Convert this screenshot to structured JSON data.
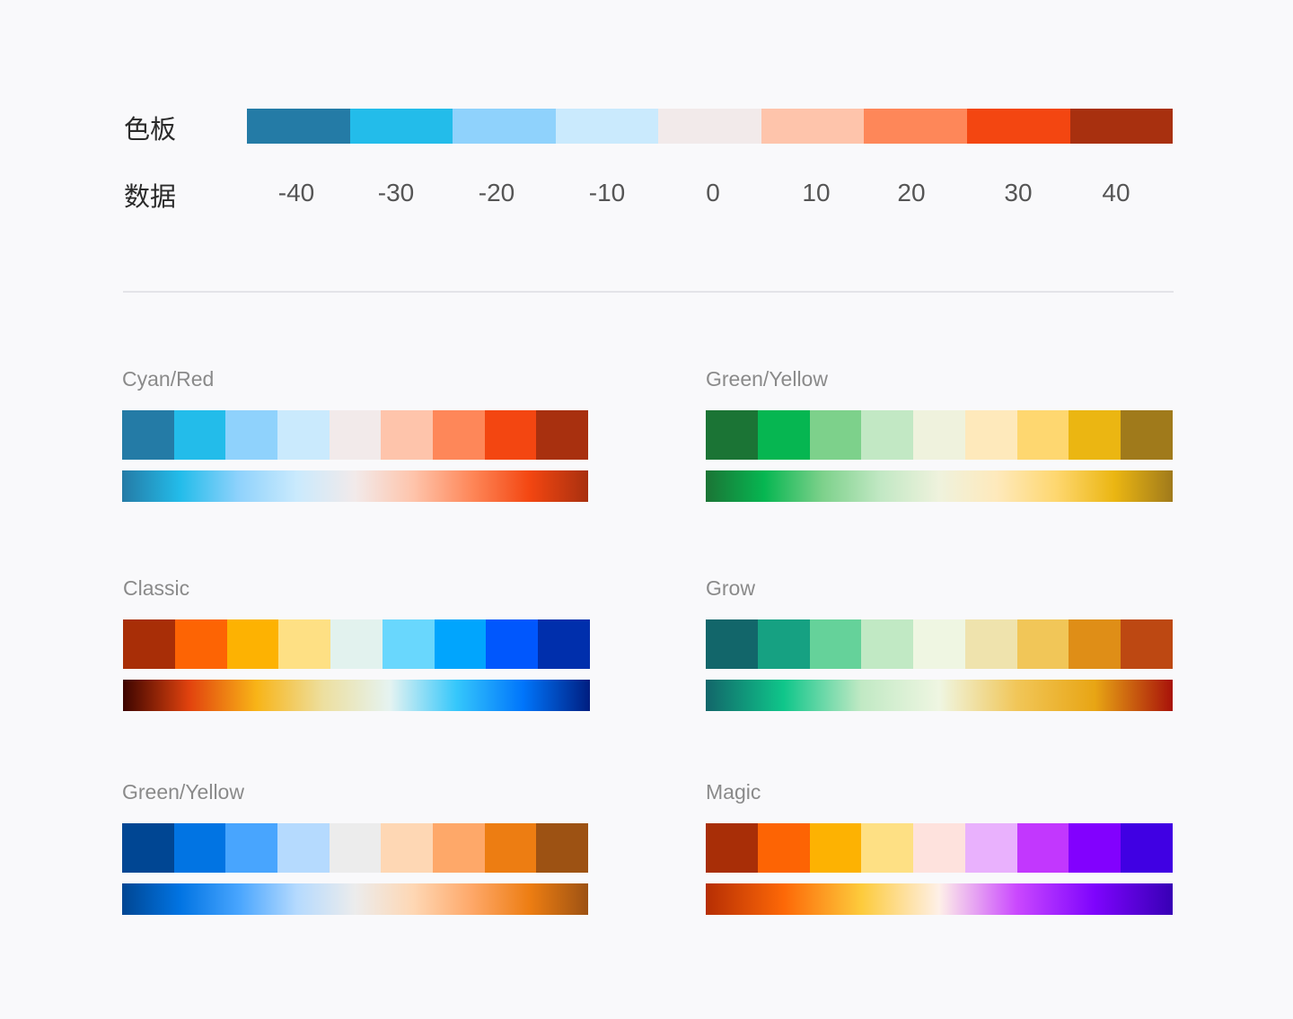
{
  "legend": {
    "palette_label": "色板",
    "data_label": "数据",
    "colors": [
      "#247ba6",
      "#23bcea",
      "#8fd2fc",
      "#caeafd",
      "#f2eaea",
      "#fec4ab",
      "#fe8759",
      "#f34611",
      "#a8300f"
    ],
    "values": [
      "-40",
      "-30",
      "-20",
      "-10",
      "0",
      "10",
      "20",
      "30",
      "40"
    ]
  },
  "palettes": [
    {
      "name": "Cyan/Red",
      "steps": [
        "#247ba6",
        "#23bcea",
        "#8fd2fc",
        "#caeafd",
        "#f2eaea",
        "#fec4ab",
        "#fe8759",
        "#f34611",
        "#a8300f"
      ]
    },
    {
      "name": "Green/Yellow",
      "steps": [
        "#1b7435",
        "#06b651",
        "#7dd18b",
        "#c2e8c4",
        "#eff2dd",
        "#fee9bb",
        "#fed770",
        "#ebb612",
        "#a07a1b"
      ]
    },
    {
      "name": "Classic",
      "steps": [
        "#a82e07",
        "#fd6404",
        "#fdb202",
        "#fee084",
        "#e2f2ee",
        "#69d7fd",
        "#01a5fd",
        "#0057fd",
        "#002fac"
      ],
      "gradient": [
        "#3d0500",
        "#e2430e",
        "#f8b417",
        "#eddf9f",
        "#e5f3f1",
        "#35c7fb",
        "#0075fb",
        "#001e80"
      ]
    },
    {
      "name": "Grow",
      "steps": [
        "#12666a",
        "#16a182",
        "#65d29a",
        "#c1e9c4",
        "#eff6e2",
        "#efe3ad",
        "#f1c658",
        "#df8e17",
        "#bd4812"
      ],
      "gradient": [
        "#12666a",
        "#0fc68a",
        "#c1e9c4",
        "#eff6e2",
        "#f1c658",
        "#e8a514",
        "#a8120a"
      ]
    },
    {
      "name": "Green/Yellow",
      "steps": [
        "#004693",
        "#0174e3",
        "#48a5fe",
        "#b5dafe",
        "#ececec",
        "#fed7b4",
        "#fea869",
        "#ed7d12",
        "#9d5213"
      ]
    },
    {
      "name": "Magic",
      "steps": [
        "#a82e07",
        "#fd6404",
        "#fdb202",
        "#fee084",
        "#fee2dd",
        "#e9b1fd",
        "#c237fe",
        "#8201fe",
        "#4000e3"
      ],
      "gradient": [
        "#b62e04",
        "#fd6807",
        "#fdcb3c",
        "#fef0e8",
        "#ca48fe",
        "#7e04fd",
        "#3700b5"
      ]
    }
  ]
}
